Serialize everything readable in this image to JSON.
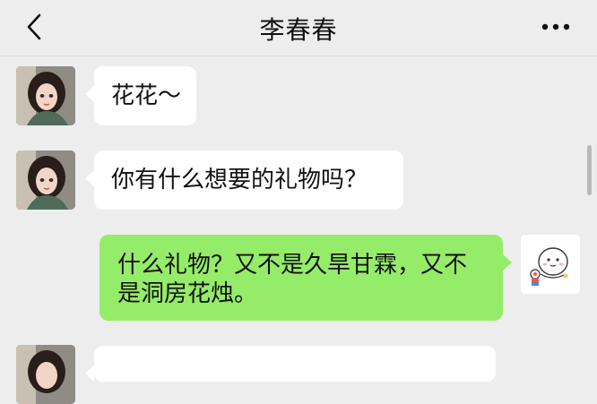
{
  "header": {
    "title": "李春春",
    "back_icon": "chevron-left-icon",
    "more_icon": "more-dots-icon"
  },
  "messages": [
    {
      "sender": "contact",
      "text": "花花～"
    },
    {
      "sender": "contact",
      "text": "你有什么想要的礼物吗？"
    },
    {
      "sender": "me",
      "text_line1": "什么礼物？又不是久旱甘霖，又不",
      "text_line2": "是洞房花烛。"
    },
    {
      "sender": "contact",
      "text": ""
    }
  ],
  "colors": {
    "background": "#ededed",
    "incoming_bubble": "#ffffff",
    "outgoing_bubble": "#95ec69"
  }
}
